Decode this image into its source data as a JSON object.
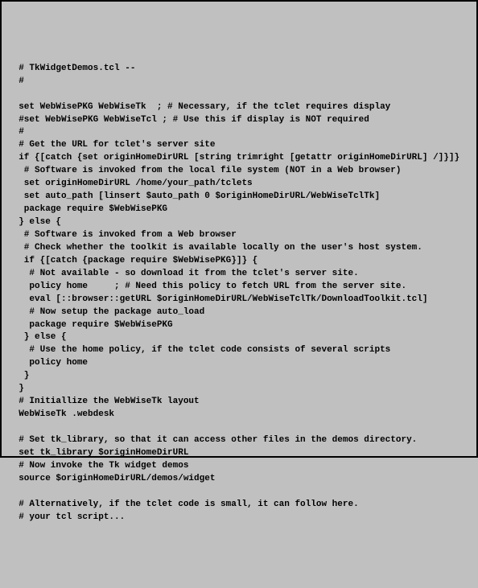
{
  "code": {
    "lines": [
      "  # TkWidgetDemos.tcl --",
      "  #",
      "",
      "  set WebWisePKG WebWiseTk  ; # Necessary, if the tclet requires display",
      "  #set WebWisePKG WebWiseTcl ; # Use this if display is NOT required",
      "  #",
      "  # Get the URL for tclet's server site",
      "  if {[catch {set originHomeDirURL [string trimright [getattr originHomeDirURL] /]}]}",
      "   # Software is invoked from the local file system (NOT in a Web browser)",
      "   set originHomeDirURL /home/your_path/tclets",
      "   set auto_path [linsert $auto_path 0 $originHomeDirURL/WebWiseTclTk]",
      "   package require $WebWisePKG",
      "  } else {",
      "   # Software is invoked from a Web browser",
      "   # Check whether the toolkit is available locally on the user's host system.",
      "   if {[catch {package require $WebWisePKG}]} {",
      "    # Not available - so download it from the tclet's server site.",
      "    policy home     ; # Need this policy to fetch URL from the server site.",
      "    eval [::browser::getURL $originHomeDirURL/WebWiseTclTk/DownloadToolkit.tcl]",
      "    # Now setup the package auto_load",
      "    package require $WebWisePKG",
      "   } else {",
      "    # Use the home policy, if the tclet code consists of several scripts",
      "    policy home",
      "   }",
      "  }",
      "  # Initiallize the WebWiseTk layout",
      "  WebWiseTk .webdesk",
      "",
      "  # Set tk_library, so that it can access other files in the demos directory.",
      "  set tk_library $originHomeDirURL",
      "  # Now invoke the Tk widget demos",
      "  source $originHomeDirURL/demos/widget",
      "",
      "  # Alternatively, if the tclet code is small, it can follow here.",
      "  # your tcl script..."
    ]
  }
}
